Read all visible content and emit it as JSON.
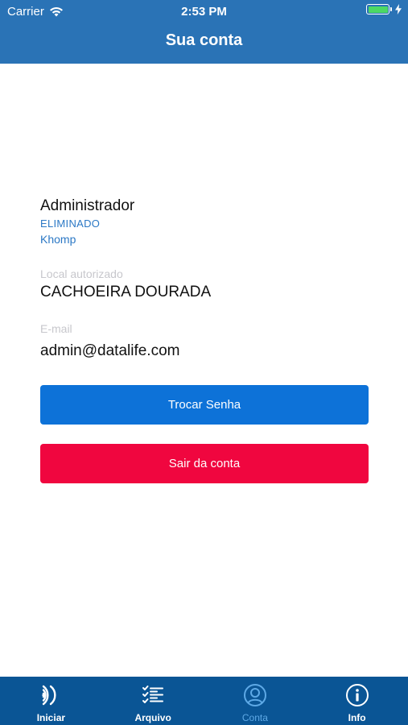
{
  "status_bar": {
    "carrier": "Carrier",
    "time": "2:53 PM"
  },
  "header": {
    "title": "Sua conta"
  },
  "user": {
    "name": "Administrador",
    "status": "ELIMINADO",
    "company": "Khomp"
  },
  "fields": {
    "local_label": "Local autorizado",
    "local_value": "CACHOEIRA DOURADA",
    "email_label": "E-mail",
    "email_value": "admin@datalife.com"
  },
  "buttons": {
    "change_password": "Trocar Senha",
    "logout": "Sair da conta"
  },
  "tabbar": {
    "tabs": [
      {
        "label": "Iniciar",
        "icon": "signal-icon"
      },
      {
        "label": "Arquivo",
        "icon": "checklist-icon"
      },
      {
        "label": "Conta",
        "icon": "user-icon",
        "active": true
      },
      {
        "label": "Info",
        "icon": "info-icon"
      }
    ]
  },
  "colors": {
    "header_bg": "#2a73b6",
    "tabbar_bg": "#0a5595",
    "primary_button": "#0d72d8",
    "danger_button": "#f0063f",
    "link_blue": "#2b78c5",
    "active_tab": "#5ea9e6"
  }
}
